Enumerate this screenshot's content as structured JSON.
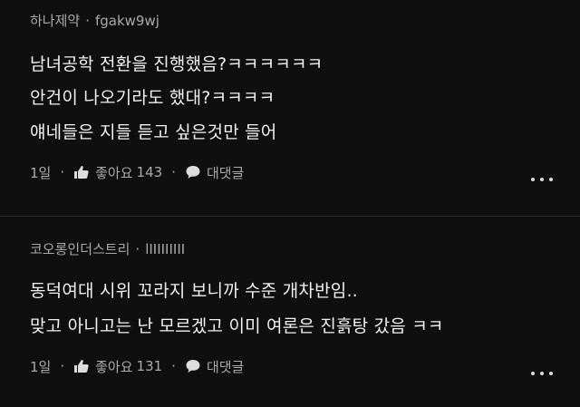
{
  "comments": [
    {
      "channel": "하나제약",
      "separator": "·",
      "user": "fgakw9wj",
      "lines": [
        "남녀공학 전환을 진행했음?ㅋㅋㅋㅋㅋㅋ",
        "안건이 나오기라도 했대?ㅋㅋㅋㅋ",
        "얘네들은 지들 듣고 싶은것만 들어"
      ],
      "time": "1일",
      "like_label": "좋아요",
      "like_count": "143",
      "reply_label": "대댓글"
    },
    {
      "channel": "코오롱인더스트리",
      "separator": "·",
      "user": "lIIIIIIIII",
      "lines": [
        "동덕여대 시위 꼬라지 보니까 수준 개차반임..",
        "맞고 아니고는 난 모르겠고 이미 여론은 진흙탕 갔음 ㅋㅋ"
      ],
      "time": "1일",
      "like_label": "좋아요",
      "like_count": "131",
      "reply_label": "대댓글"
    }
  ],
  "dot_sep": "·",
  "icons": {
    "like": "thumbs-up-icon",
    "reply": "speech-bubble-icon",
    "more": "more-horizontal-icon"
  },
  "colors": {
    "background": "#0f0f0f",
    "text_primary": "#f1f1f1",
    "text_secondary": "#aaaaaa"
  }
}
